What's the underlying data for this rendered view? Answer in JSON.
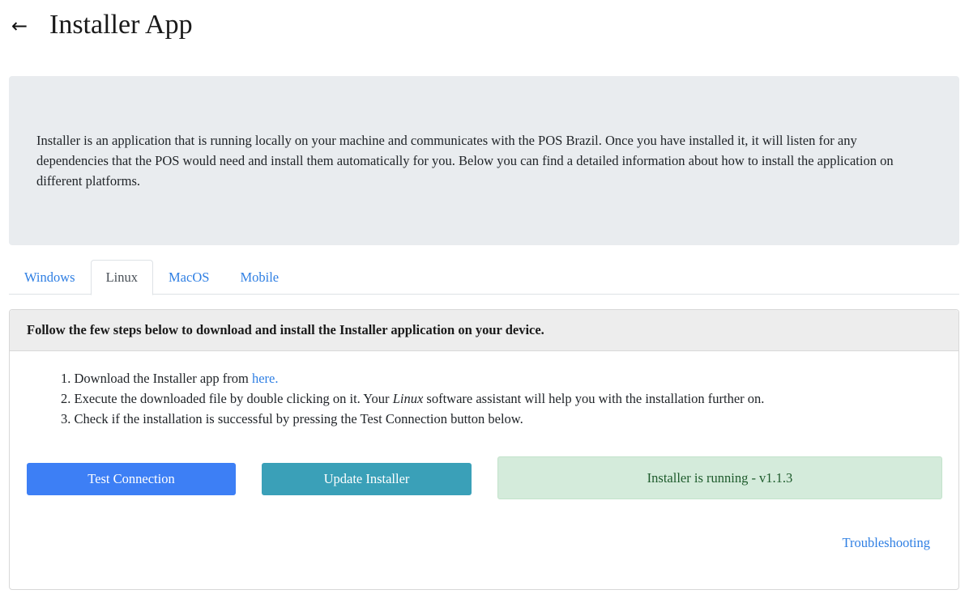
{
  "header": {
    "back_icon": "←",
    "title": "Installer App"
  },
  "intro": {
    "text": "Installer is an application that is running locally on your machine and communicates with the POS Brazil. Once you have installed it, it will listen for any dependencies that the POS would need and install them automatically for you. Below you can find a detailed information about how to install the application on different platforms."
  },
  "tabs": [
    {
      "label": "Windows",
      "active": false
    },
    {
      "label": "Linux",
      "active": true
    },
    {
      "label": "MacOS",
      "active": false
    },
    {
      "label": "Mobile",
      "active": false
    }
  ],
  "card": {
    "header": "Follow the few steps below to download and install the Installer application on your device.",
    "steps": {
      "step1_prefix": "1. Download the Installer app from ",
      "step1_link": "here.",
      "step2_prefix": "2. Execute the downloaded file by double clicking on it. Your ",
      "step2_em": "Linux",
      "step2_suffix": " software assistant will help you with the installation further on.",
      "step3": "3. Check if the installation is successful by pressing the Test Connection button below."
    },
    "buttons": {
      "test_connection": "Test Connection",
      "update_installer": "Update Installer"
    },
    "status": "Installer is running - v1.1.3",
    "troubleshooting": "Troubleshooting"
  }
}
